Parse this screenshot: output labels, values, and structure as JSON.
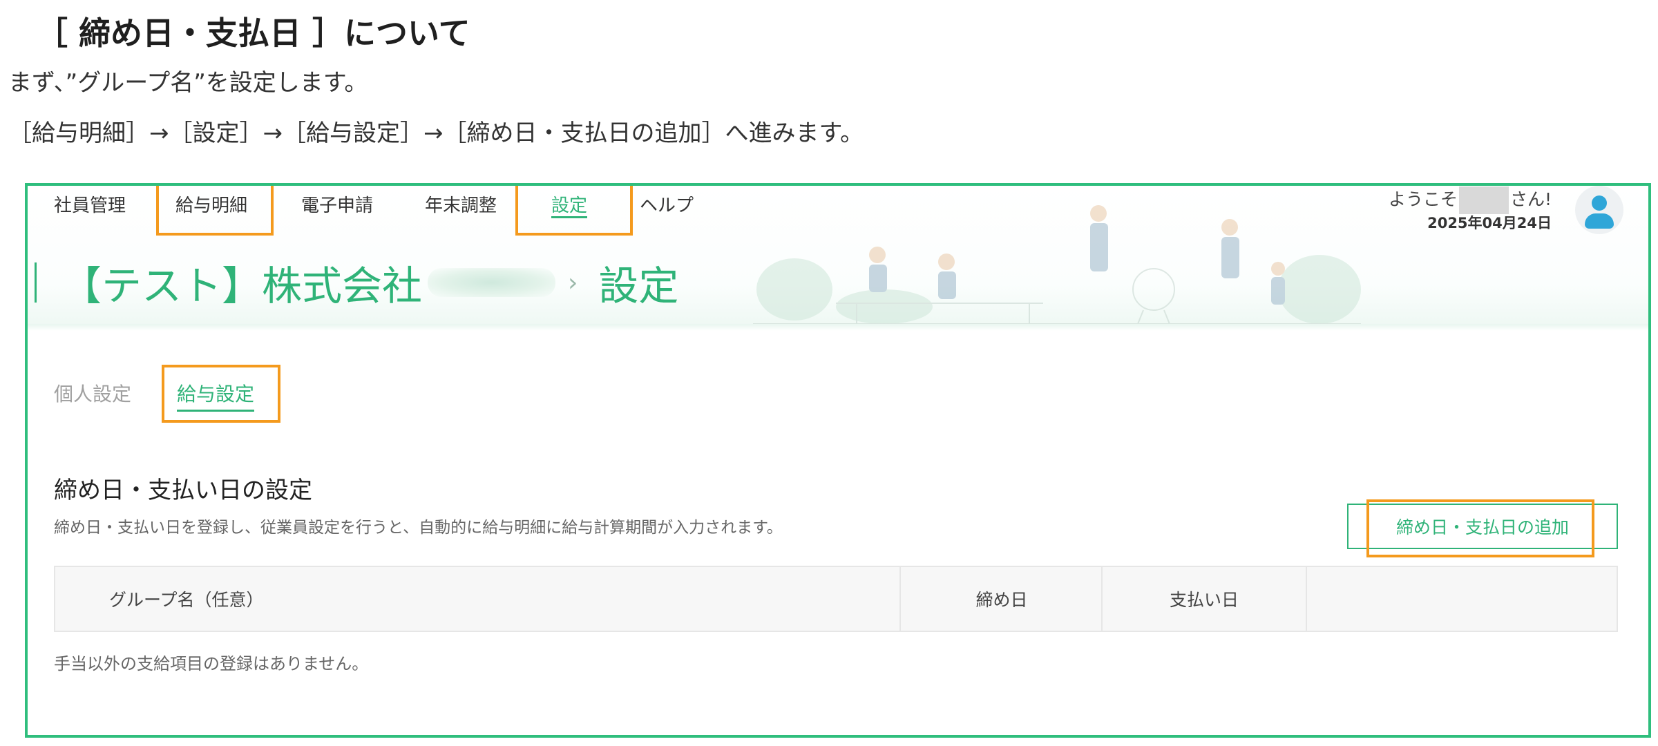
{
  "doc": {
    "title": "［ 締め日・支払日 ］について",
    "line1": "まず、”グループ名”を設定します。",
    "line2": "［給与明細］→［設定］→［給与設定］→［締め日・支払日の追加］へ進みます。"
  },
  "nav": {
    "items": [
      "社員管理",
      "給与明細",
      "電子申請",
      "年末調整",
      "設定",
      "ヘルプ"
    ],
    "active_index": 4
  },
  "user": {
    "welcome_prefix": "ようこそ",
    "welcome_suffix": "さん!",
    "date": "2025年04月24日"
  },
  "header": {
    "company_prefix": "【テスト】株式会社",
    "separator": "›",
    "page": "設定"
  },
  "subtabs": [
    "個人設定",
    "給与設定"
  ],
  "section": {
    "title": "締め日・支払い日の設定",
    "description": "締め日・支払い日を登録し、従業員設定を行うと、自動的に給与明細に給与計算期間が入力されます。",
    "add_button_label": "締め日・支払日の追加"
  },
  "table": {
    "headers": [
      "グループ名（任意）",
      "締め日",
      "支払い日",
      ""
    ],
    "empty_message": "手当以外の支給項目の登録はありません。"
  },
  "colors": {
    "accent_green": "#2fb378",
    "frame_green": "#2fbe7d",
    "highlight_orange": "#f49a1d"
  }
}
